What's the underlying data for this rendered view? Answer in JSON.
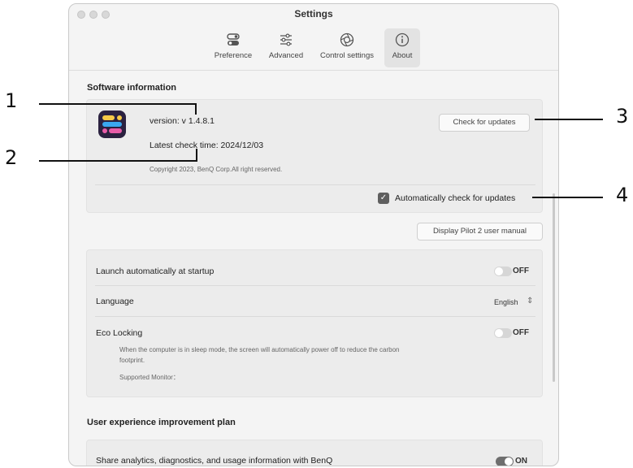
{
  "window": {
    "title": "Settings"
  },
  "toolbar": {
    "items": [
      {
        "label": "Preference",
        "icon": "toggles-icon"
      },
      {
        "label": "Advanced",
        "icon": "sliders-icon"
      },
      {
        "label": "Control settings",
        "icon": "aperture-icon"
      },
      {
        "label": "About",
        "icon": "info-icon",
        "active": true
      }
    ]
  },
  "software": {
    "section_title": "Software information",
    "version": "version: v 1.4.8.1",
    "latest_check": "Latest check time: 2024/12/03",
    "copyright": "Copyright  2023, BenQ Corp.All right reserved.",
    "check_updates_label": "Check for updates",
    "auto_check_label": "Automatically check for updates",
    "auto_check_checked": true
  },
  "manual_button_label": "Display Pilot 2 user manual",
  "settings": {
    "launch_label": "Launch automatically at startup",
    "launch_state": "OFF",
    "language_label": "Language",
    "language_value": "English",
    "eco_label": "Eco Locking",
    "eco_state": "OFF",
    "eco_desc_line1": "When the computer is in sleep mode, the screen will automatically power off to reduce the carbon",
    "eco_desc_line2": "footprint.",
    "supported_monitor": "Supported Monitor："
  },
  "ux_plan": {
    "section_title": "User experience improvement plan",
    "share_label": "Share analytics, diagnostics, and usage information with BenQ",
    "share_state": "ON"
  },
  "callouts": [
    "1",
    "2",
    "3",
    "4"
  ],
  "colors": {
    "app_icon_bg": "#2b2140",
    "app_icon_yellow": "#f7c948",
    "app_icon_blue": "#3aa8f0",
    "app_icon_pink": "#e85ca8",
    "checkbox": "#5f5f5f"
  }
}
